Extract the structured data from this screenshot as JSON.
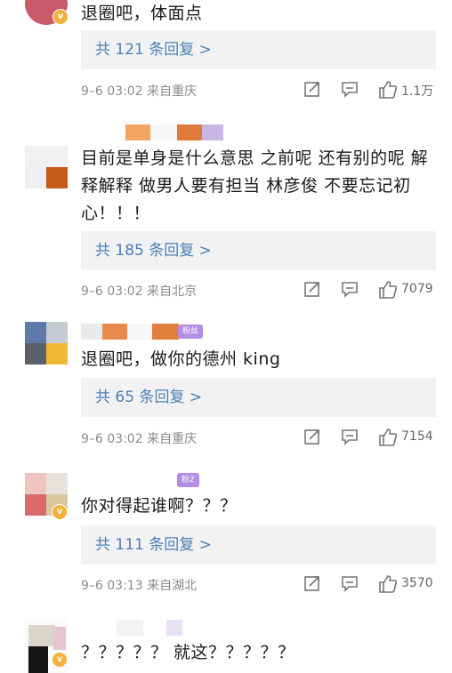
{
  "comments": [
    {
      "text": "退圈吧，体面点",
      "replies": "共 121 条回复 >",
      "date": "9–6 03:02",
      "location": "来自重庆",
      "likes": "1.1万"
    },
    {
      "text": "目前是单身是什么意思 之前呢 还有别的呢 解释解释 做男人要有担当 林彦俊 不要忘记初心！！！",
      "replies": "共 185 条回复 >",
      "date": "9–6 03:02",
      "location": "来自北京",
      "likes": "7079"
    },
    {
      "text": "退圈吧，做你的德州 king",
      "replies": "共 65 条回复 >",
      "date": "9–6 03:02",
      "location": "来自重庆",
      "likes": "7154",
      "fan_badge": "粉丝"
    },
    {
      "text": "你对得起谁啊？？？",
      "replies": "共 111 条回复 >",
      "date": "9–6 03:13",
      "location": "来自湖北",
      "likes": "3570",
      "fan_badge": "粉2"
    },
    {
      "text": "？？？？？ 就这？？？？？"
    }
  ],
  "icons": {
    "share": "share-icon",
    "comment": "comment-icon",
    "like": "thumbs-up-icon",
    "verified": "verified-badge-icon"
  },
  "colors": {
    "link": "#4c7fb8",
    "reply_bg": "#f2f2f2",
    "meta": "#8a8a8a",
    "verified": "#f3b13c"
  }
}
